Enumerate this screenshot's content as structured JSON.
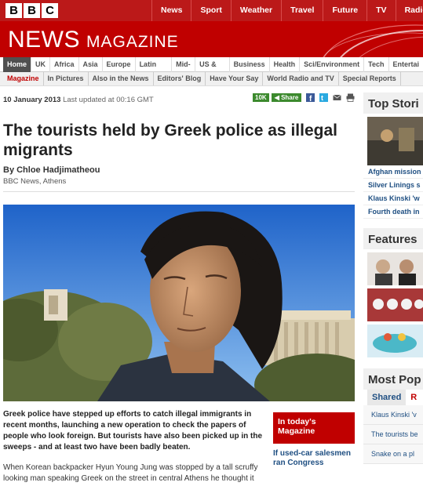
{
  "brand": {
    "letters": [
      "B",
      "B",
      "C"
    ]
  },
  "topnav": [
    "News",
    "Sport",
    "Weather",
    "Travel",
    "Future",
    "TV",
    "Radio"
  ],
  "masthead": {
    "news": "NEWS",
    "magazine": "MAGAZINE"
  },
  "secnav": [
    "Home",
    "UK",
    "Africa",
    "Asia",
    "Europe",
    "Latin America",
    "Mid-East",
    "US & Canada",
    "Business",
    "Health",
    "Sci/Environment",
    "Tech",
    "Entertai"
  ],
  "subnav": [
    "Magazine",
    "In Pictures",
    "Also in the News",
    "Editors' Blog",
    "Have Your Say",
    "World Radio and TV",
    "Special Reports"
  ],
  "article": {
    "date": "10 January 2013",
    "updated": "Last updated at 00:16 GMT",
    "share_count": "10K",
    "share_label": "Share",
    "headline": "The tourists held by Greek police as illegal migrants",
    "byline": "By Chloe Hadjimatheou",
    "byline_sub": "BBC News, Athens",
    "intro": "Greek police have stepped up efforts to catch illegal immigrants in recent months, launching a new operation to check the papers of people who look foreign. But tourists have also been picked up in the sweeps - and at least two have been badly beaten.",
    "body1": "When Korean backpacker Hyun Young Jung was stopped by a tall scruffy looking man speaking Greek on the street in central Athens he thought it"
  },
  "today": {
    "title": "In today's Magazine",
    "link": "If used-car salesmen ran Congress"
  },
  "right": {
    "top_stories": "Top Stori",
    "top_links": [
      "Afghan mission",
      "Silver Linings s",
      "Klaus Kinski 'w",
      "Fourth death in"
    ],
    "features": "Features",
    "most_popular": "Most Pop",
    "tab_shared": "Shared",
    "tab_read": "R",
    "popular": [
      "Klaus Kinski 'v",
      "The tourists be",
      "Snake on a pl"
    ]
  },
  "colors": {
    "bbc_red": "#bb1919",
    "masthead": "#c00000",
    "share_green": "#3c8a2e",
    "link_blue": "#1f4f82"
  }
}
